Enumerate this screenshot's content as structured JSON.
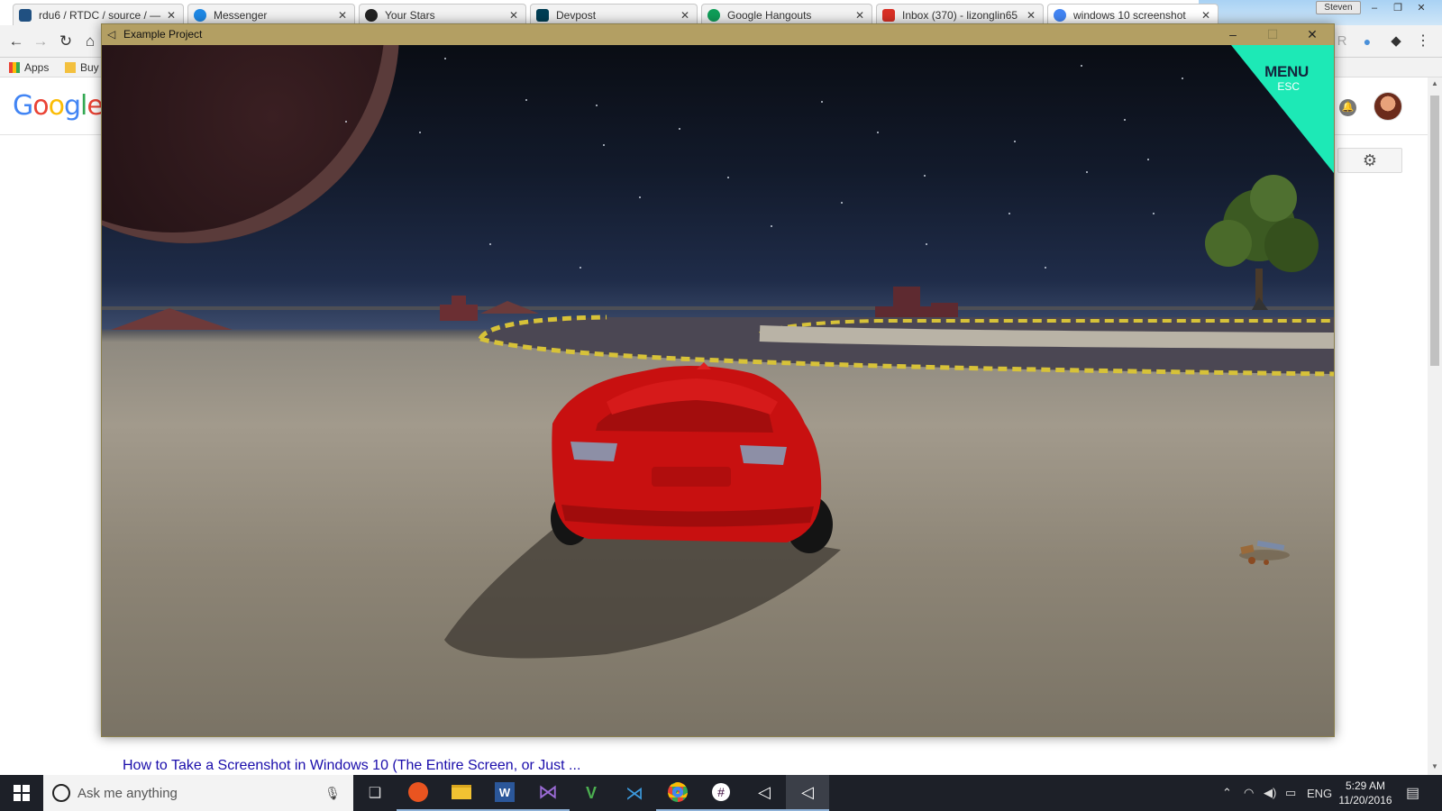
{
  "browser": {
    "tabs": [
      {
        "label": "rdu6 / RTDC / source / —",
        "icon": "bitbucket-icon",
        "color": "#205081"
      },
      {
        "label": "Messenger",
        "icon": "messenger-icon",
        "color": "#1e88e5"
      },
      {
        "label": "Your Stars",
        "icon": "github-icon",
        "color": "#222222"
      },
      {
        "label": "Devpost",
        "icon": "devpost-icon",
        "color": "#003e54"
      },
      {
        "label": "Google Hangouts",
        "icon": "hangouts-icon",
        "color": "#0f9d58"
      },
      {
        "label": "Inbox (370) - lizonglin65",
        "icon": "gmail-icon",
        "color": "#d93025"
      },
      {
        "label": "windows 10 screenshot",
        "icon": "google-icon",
        "color": "#4285f4"
      }
    ],
    "user": "Steven",
    "bookmarks": {
      "apps": "Apps",
      "buy": "Buy"
    },
    "google_logo": "Google",
    "result_link": "How to Take a Screenshot in Windows 10 (The Entire Screen, or Just ..."
  },
  "game_window": {
    "title": "Example Project",
    "menu_label": "MENU",
    "menu_hint": "ESC",
    "colors": {
      "titlebar": "#b39f63",
      "menu": "#1de9b6",
      "car": "#d11414"
    }
  },
  "taskbar": {
    "search_placeholder": "Ask me anything",
    "apps": [
      "ubuntu-icon",
      "file-explorer-icon",
      "word-icon",
      "visual-studio-icon",
      "vim-icon",
      "vscode-icon",
      "chrome-icon",
      "slack-icon",
      "unity-icon",
      "unity-icon"
    ],
    "language": "ENG",
    "time": "5:29 AM",
    "date": "11/20/2016"
  }
}
